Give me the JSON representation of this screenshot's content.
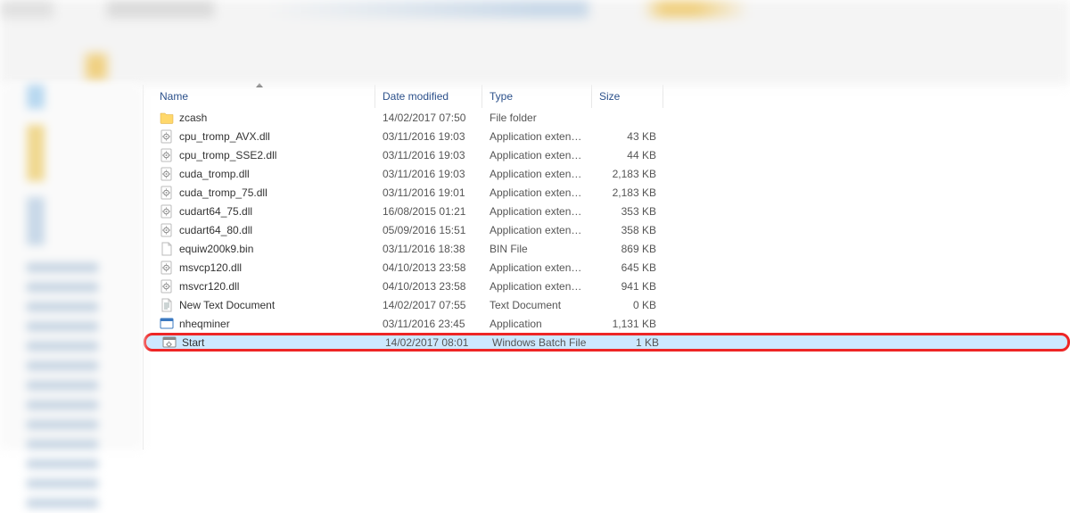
{
  "columns": {
    "name": "Name",
    "date": "Date modified",
    "type": "Type",
    "size": "Size"
  },
  "files": [
    {
      "name": "zcash",
      "date": "14/02/2017 07:50",
      "type": "File folder",
      "size": "",
      "icon": "folder"
    },
    {
      "name": "cpu_tromp_AVX.dll",
      "date": "03/11/2016 19:03",
      "type": "Application extens...",
      "size": "43 KB",
      "icon": "dll"
    },
    {
      "name": "cpu_tromp_SSE2.dll",
      "date": "03/11/2016 19:03",
      "type": "Application extens...",
      "size": "44 KB",
      "icon": "dll"
    },
    {
      "name": "cuda_tromp.dll",
      "date": "03/11/2016 19:03",
      "type": "Application extens...",
      "size": "2,183 KB",
      "icon": "dll"
    },
    {
      "name": "cuda_tromp_75.dll",
      "date": "03/11/2016 19:01",
      "type": "Application extens...",
      "size": "2,183 KB",
      "icon": "dll"
    },
    {
      "name": "cudart64_75.dll",
      "date": "16/08/2015 01:21",
      "type": "Application extens...",
      "size": "353 KB",
      "icon": "dll"
    },
    {
      "name": "cudart64_80.dll",
      "date": "05/09/2016 15:51",
      "type": "Application extens...",
      "size": "358 KB",
      "icon": "dll"
    },
    {
      "name": "equiw200k9.bin",
      "date": "03/11/2016 18:38",
      "type": "BIN File",
      "size": "869 KB",
      "icon": "blank"
    },
    {
      "name": "msvcp120.dll",
      "date": "04/10/2013 23:58",
      "type": "Application extens...",
      "size": "645 KB",
      "icon": "dll"
    },
    {
      "name": "msvcr120.dll",
      "date": "04/10/2013 23:58",
      "type": "Application extens...",
      "size": "941 KB",
      "icon": "dll"
    },
    {
      "name": "New Text Document",
      "date": "14/02/2017 07:55",
      "type": "Text Document",
      "size": "0 KB",
      "icon": "text"
    },
    {
      "name": "nheqminer",
      "date": "03/11/2016 23:45",
      "type": "Application",
      "size": "1,131 KB",
      "icon": "exe"
    },
    {
      "name": "Start",
      "date": "14/02/2017 08:01",
      "type": "Windows Batch File",
      "size": "1 KB",
      "icon": "bat",
      "selected": true,
      "highlighted": true
    }
  ]
}
